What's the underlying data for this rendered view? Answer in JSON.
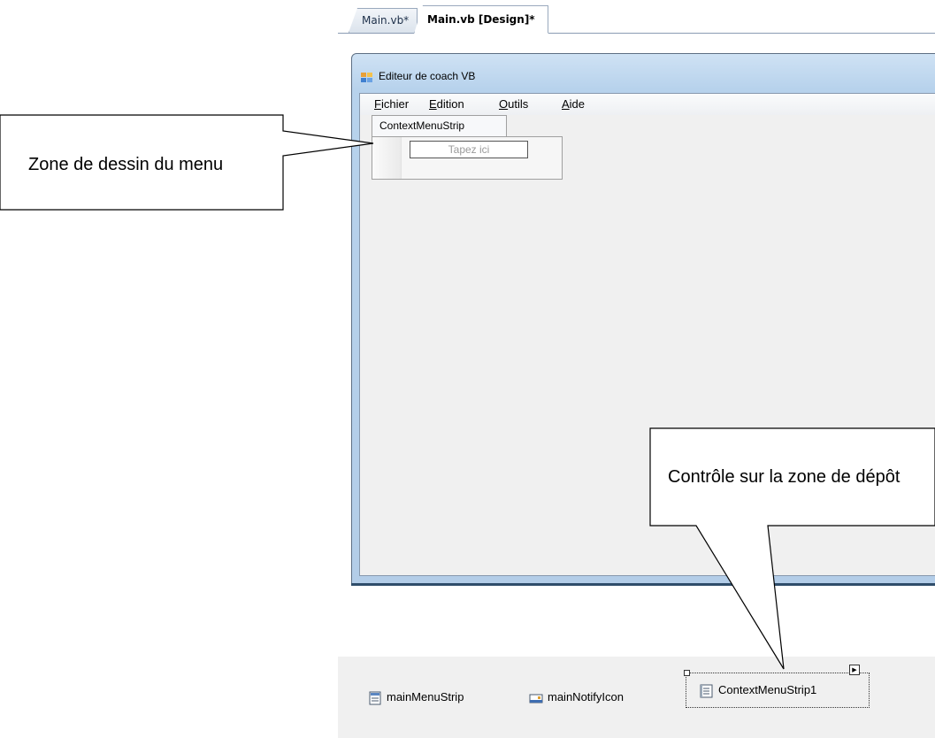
{
  "tabs": [
    {
      "label": "Main.vb*",
      "active": false
    },
    {
      "label": "Main.vb [Design]*",
      "active": true
    }
  ],
  "window": {
    "title": "Editeur de coach VB",
    "icon": "form-window-icon"
  },
  "menubar": {
    "items": [
      {
        "underline": "F",
        "rest": "ichier"
      },
      {
        "underline": "E",
        "rest": "dition"
      },
      {
        "underline": "O",
        "rest": "utils"
      },
      {
        "underline": "A",
        "rest": "ide"
      }
    ]
  },
  "context_menu": {
    "tab_label": "ContextMenuStrip",
    "placeholder": "Tapez ici"
  },
  "component_tray": {
    "items": [
      {
        "label": "mainMenuStrip",
        "icon": "menustrip-icon"
      },
      {
        "label": "mainNotifyIcon",
        "icon": "notifyicon-icon"
      },
      {
        "label": "ContextMenuStrip1",
        "icon": "contextmenustrip-icon",
        "selected": true
      }
    ]
  },
  "callouts": {
    "drawing_zone": "Zone de dessin du menu",
    "drop_zone": "Contrôle sur la zone de dépôt"
  },
  "colors": {
    "window_frame": "#b7d2ec",
    "client_bg": "#f0f0f0",
    "tray_bg": "#f0f0f0"
  }
}
